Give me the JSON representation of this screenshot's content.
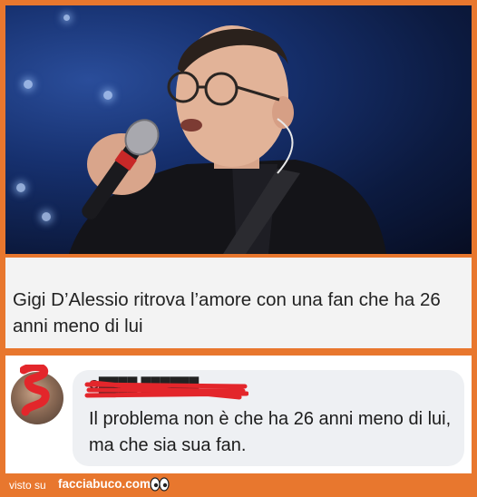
{
  "headline": {
    "text": "Gigi D’Alessio ritrova l’amore con una fan che ha 26 anni meno di lui"
  },
  "comment": {
    "author": "C████ ██████",
    "text": "Il problema non è che ha 26 anni meno di lui, ma che sia sua fan."
  },
  "footer": {
    "prefix": "visto su",
    "site": "facciabuco.com",
    "logo_icon": "eyes-icon"
  },
  "colors": {
    "frame": "#e8772e",
    "headline_bg": "#f3f3f3",
    "bubble_bg": "#eef0f3",
    "redaction": "#e3262b"
  }
}
